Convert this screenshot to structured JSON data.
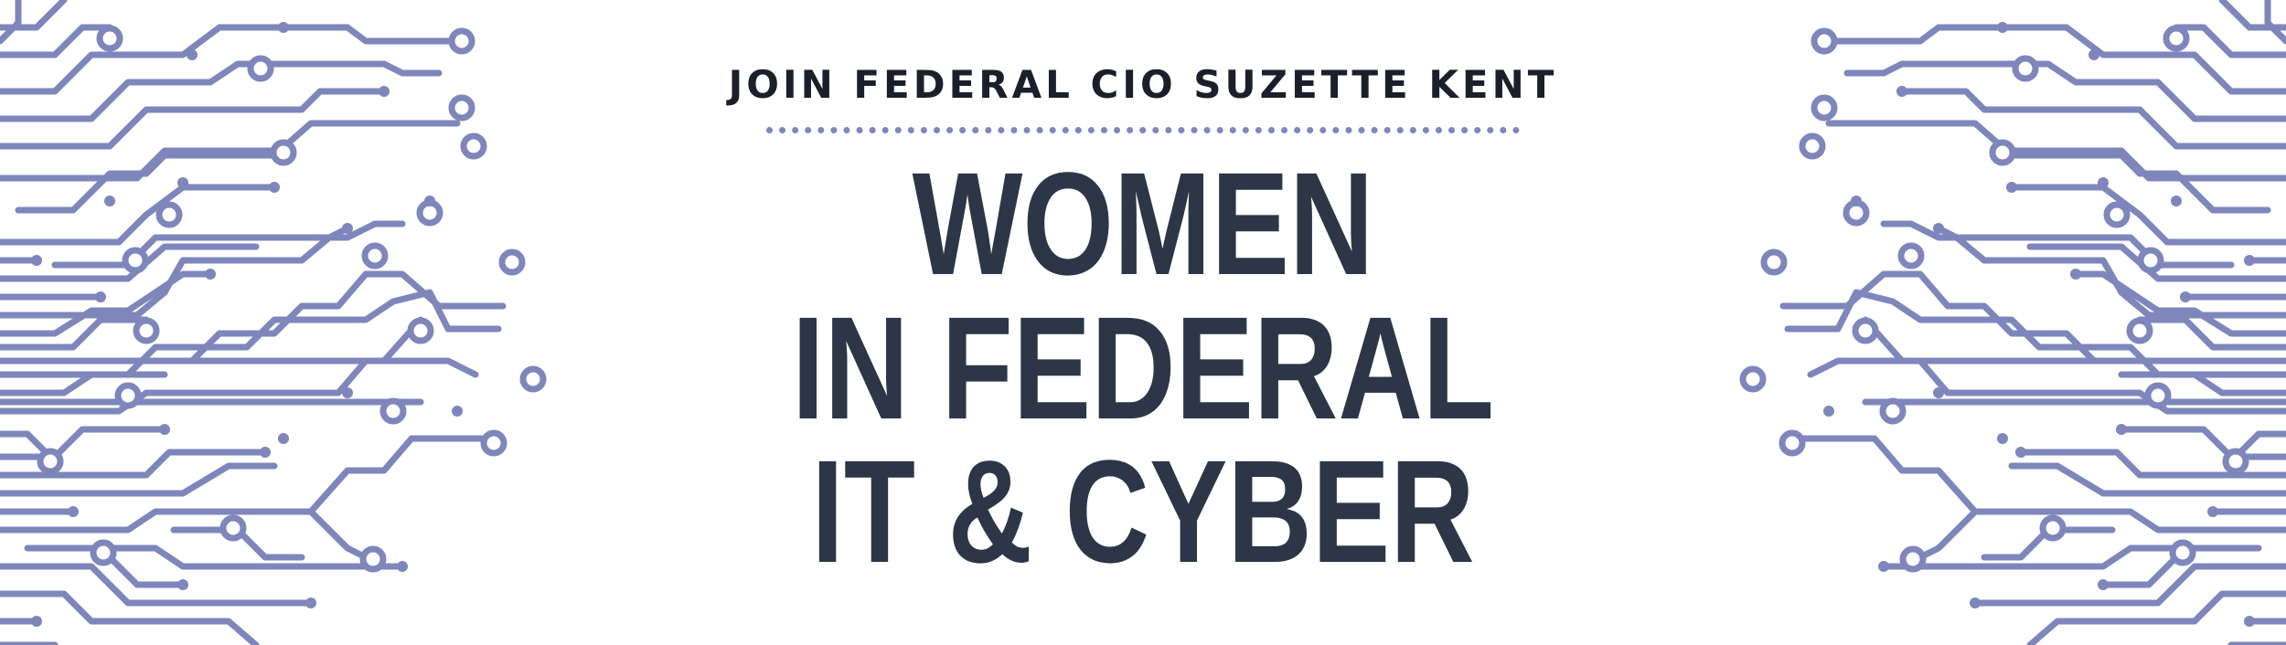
{
  "banner": {
    "subtitle": "JOIN FEDERAL CIO SUZETTE KENT",
    "title_lines": [
      "WOMEN",
      "IN FEDERAL",
      "IT & CYBER"
    ]
  },
  "colors": {
    "background": "#ffffff",
    "title_text": "#2c3646",
    "subtitle_text": "#1b1f2a",
    "circuit": "#7f86bb"
  },
  "decoration": {
    "left": "circuit-board-pattern",
    "right": "circuit-board-pattern"
  }
}
